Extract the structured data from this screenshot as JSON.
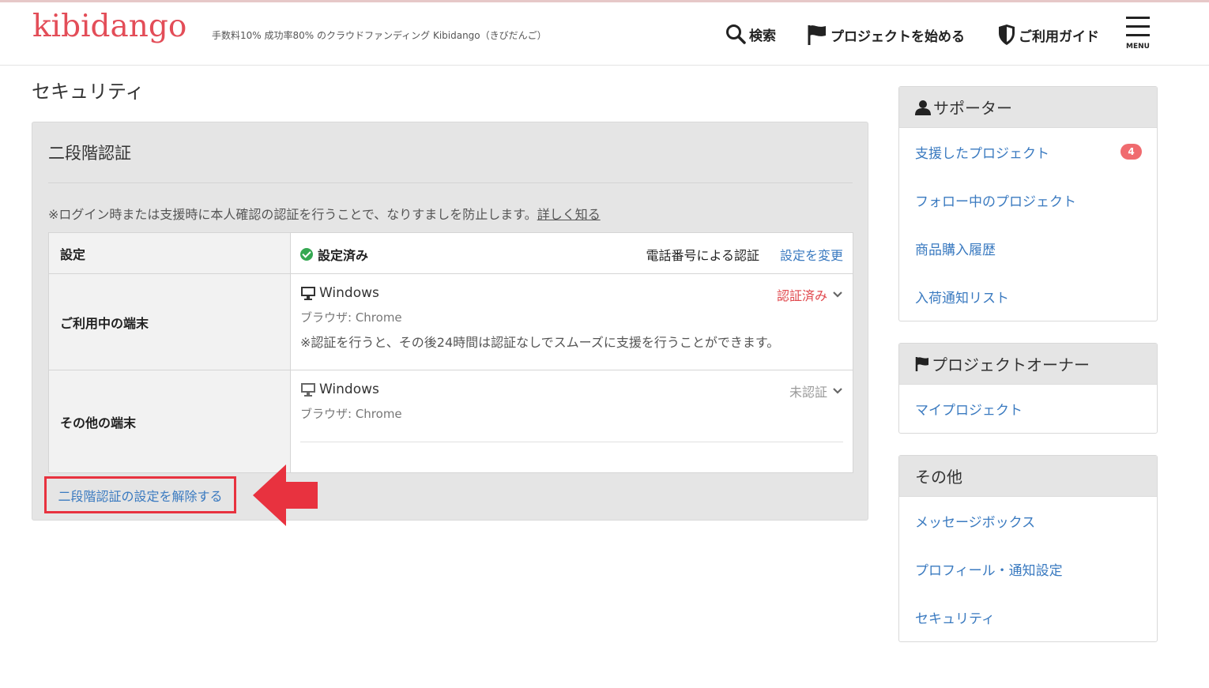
{
  "header": {
    "logo": "kibidango",
    "tagline": "手数料10% 成功率80% のクラウドファンディング Kibidango（きびだんご）",
    "nav": {
      "search": "検索",
      "start_project": "プロジェクトを始める",
      "guide": "ご利用ガイド",
      "menu": "MENU"
    },
    "icons": [
      "search-icon",
      "flag-icon",
      "shield-icon",
      "hamburger-icon"
    ]
  },
  "page": {
    "title": "セキュリティ"
  },
  "two_factor": {
    "title": "二段階認証",
    "description": "※ログイン時または支援時に本人確認の認証を行うことで、なりすましを防止します。",
    "learn_more": "詳しく知る",
    "settings_label": "設定",
    "status": "設定済み",
    "method": "電話番号による認証",
    "change_link": "設定を変更",
    "current_device_label": "ご利用中の端末",
    "other_device_label": "その他の端末",
    "devices": [
      {
        "name": "Windows",
        "browser": "ブラウザ: Chrome",
        "state": "認証済み",
        "note": "※認証を行うと、その後24時間は認証なしでスムーズに支援を行うことができます。"
      },
      {
        "name": "Windows",
        "browser": "ブラウザ: Chrome",
        "state": "未認証"
      }
    ],
    "disable_link": "二段階認証の設定を解除する"
  },
  "sidebar": {
    "supporter": {
      "title": "サポーター",
      "items": [
        {
          "label": "支援したプロジェクト",
          "badge": "4"
        },
        {
          "label": "フォロー中のプロジェクト"
        },
        {
          "label": "商品購入履歴"
        },
        {
          "label": "入荷通知リスト"
        }
      ]
    },
    "owner": {
      "title": "プロジェクトオーナー",
      "items": [
        {
          "label": "マイプロジェクト"
        }
      ]
    },
    "other": {
      "title": "その他",
      "items": [
        {
          "label": "メッセージボックス"
        },
        {
          "label": "プロフィール・通知設定"
        },
        {
          "label": "セキュリティ"
        }
      ]
    }
  },
  "colors": {
    "brand": "#e34d58",
    "link": "#3a7ac0",
    "verified": "#e0474c",
    "highlight": "#e8323f",
    "badge": "#f06b6f"
  }
}
